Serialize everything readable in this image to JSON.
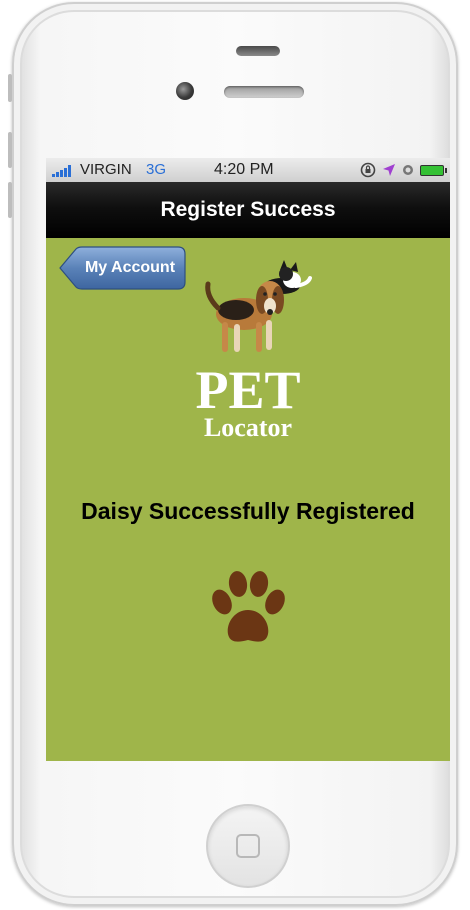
{
  "status_bar": {
    "carrier": "VIRGIN",
    "network": "3G",
    "time": "4:20 PM",
    "icons": [
      "rotation-lock-icon",
      "location-arrow-icon",
      "alarm-icon",
      "battery-icon"
    ]
  },
  "nav": {
    "title": "Register Success",
    "back_label": "My Account"
  },
  "logo": {
    "line1": "PET",
    "line2": "Locator"
  },
  "message": "Daisy Successfully Registered",
  "colors": {
    "screen_background": "#9fb54a",
    "nav_bar": "#000000",
    "back_button": "#5a82b8",
    "paw": "#6b3614",
    "signal": "#2a6fd6",
    "battery": "#35c135"
  }
}
